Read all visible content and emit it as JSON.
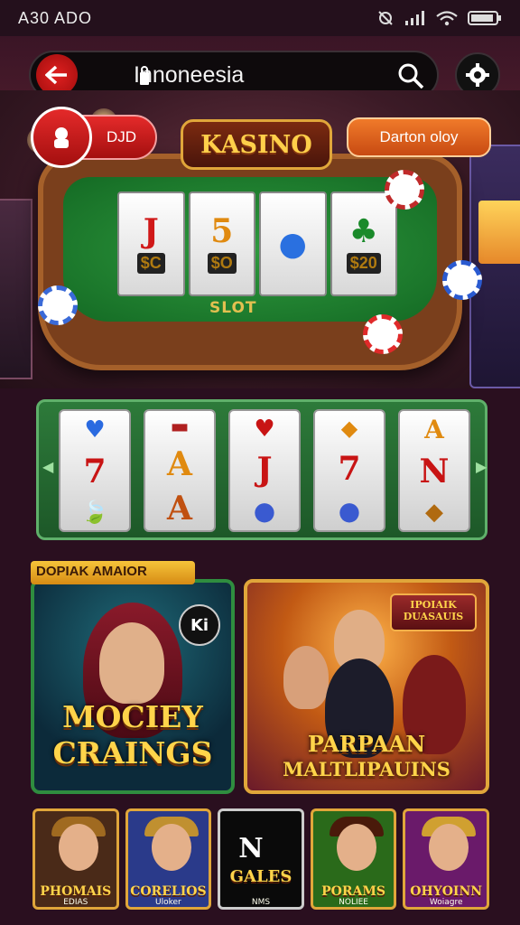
{
  "status_bar": {
    "time": "A30 ADO"
  },
  "search": {
    "query": "Innoneesia"
  },
  "hero": {
    "logo": "KASINO",
    "left_pill": "DJD",
    "right_pill": "Darton oloy",
    "table_label": "SLOT",
    "reels": [
      {
        "top": "J",
        "bottom": "$C"
      },
      {
        "top": "5",
        "bottom": "$O"
      },
      {
        "top": "●",
        "bottom": ""
      },
      {
        "top": "♣",
        "bottom": "$20"
      }
    ]
  },
  "strip": {
    "reels": [
      {
        "a": "♥",
        "b": "7",
        "c": "🍃"
      },
      {
        "a": "▬",
        "b": "A",
        "c": "A"
      },
      {
        "a": "♥",
        "b": "J",
        "c": "●"
      },
      {
        "a": "◆",
        "b": "7",
        "c": "●"
      },
      {
        "a": "A",
        "b": "N",
        "c": "◆"
      }
    ]
  },
  "featured": {
    "label": "DOPIAK AMAIOR",
    "card_a": {
      "line1": "MOCIEY",
      "line2": "CRAINGS",
      "badge": "Ki"
    },
    "card_b": {
      "line1": "PARPAAN",
      "line2": "MALTLIPAUINS",
      "banner": "IPOIAIK DUASAUIS"
    }
  },
  "thumbnails": [
    {
      "title": "PHOMAIS",
      "sub": "EDIAS",
      "color": "#4a2a18"
    },
    {
      "title": "CORELIOS",
      "sub": "Uloker",
      "color": "#2a3a8a"
    },
    {
      "title": "GALES",
      "sub": "NMS",
      "color": "#0a0a0a"
    },
    {
      "title": "PORAMS",
      "sub": "NOLIEE",
      "color": "#2a6a1a"
    },
    {
      "title": "OHYOINN",
      "sub": "Woiagre",
      "color": "#6a1a6a"
    }
  ]
}
